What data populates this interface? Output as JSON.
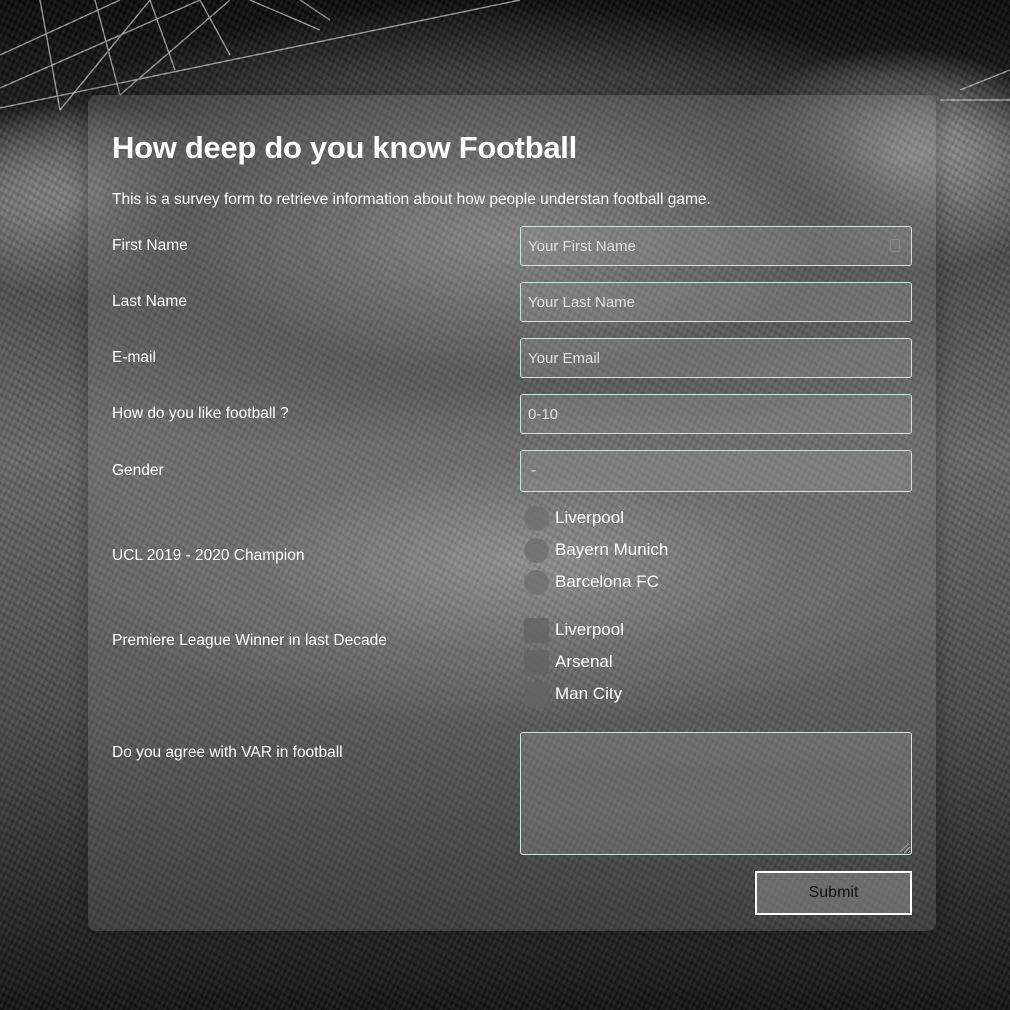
{
  "form": {
    "title": "How deep do you know Football",
    "description": "This is a survey form to retrieve information about how people understan football game.",
    "fields": {
      "first_name": {
        "label": "First Name",
        "placeholder": "Your First Name"
      },
      "last_name": {
        "label": "Last Name",
        "placeholder": "Your Last Name"
      },
      "email": {
        "label": "E-mail",
        "placeholder": "Your Email"
      },
      "rating": {
        "label": "How do you like football ?",
        "placeholder": "0-10"
      },
      "gender": {
        "label": "Gender",
        "selected": "-"
      }
    },
    "ucl": {
      "label": "UCL 2019 - 2020 Champion",
      "options": [
        "Liverpool",
        "Bayern Munich",
        "Barcelona FC"
      ]
    },
    "premier_league": {
      "label": "Premiere League Winner in last Decade",
      "options": [
        "Liverpool",
        "Arsenal",
        "Man City"
      ]
    },
    "var": {
      "label": "Do you agree with VAR in football"
    },
    "submit_label": "Submit"
  }
}
